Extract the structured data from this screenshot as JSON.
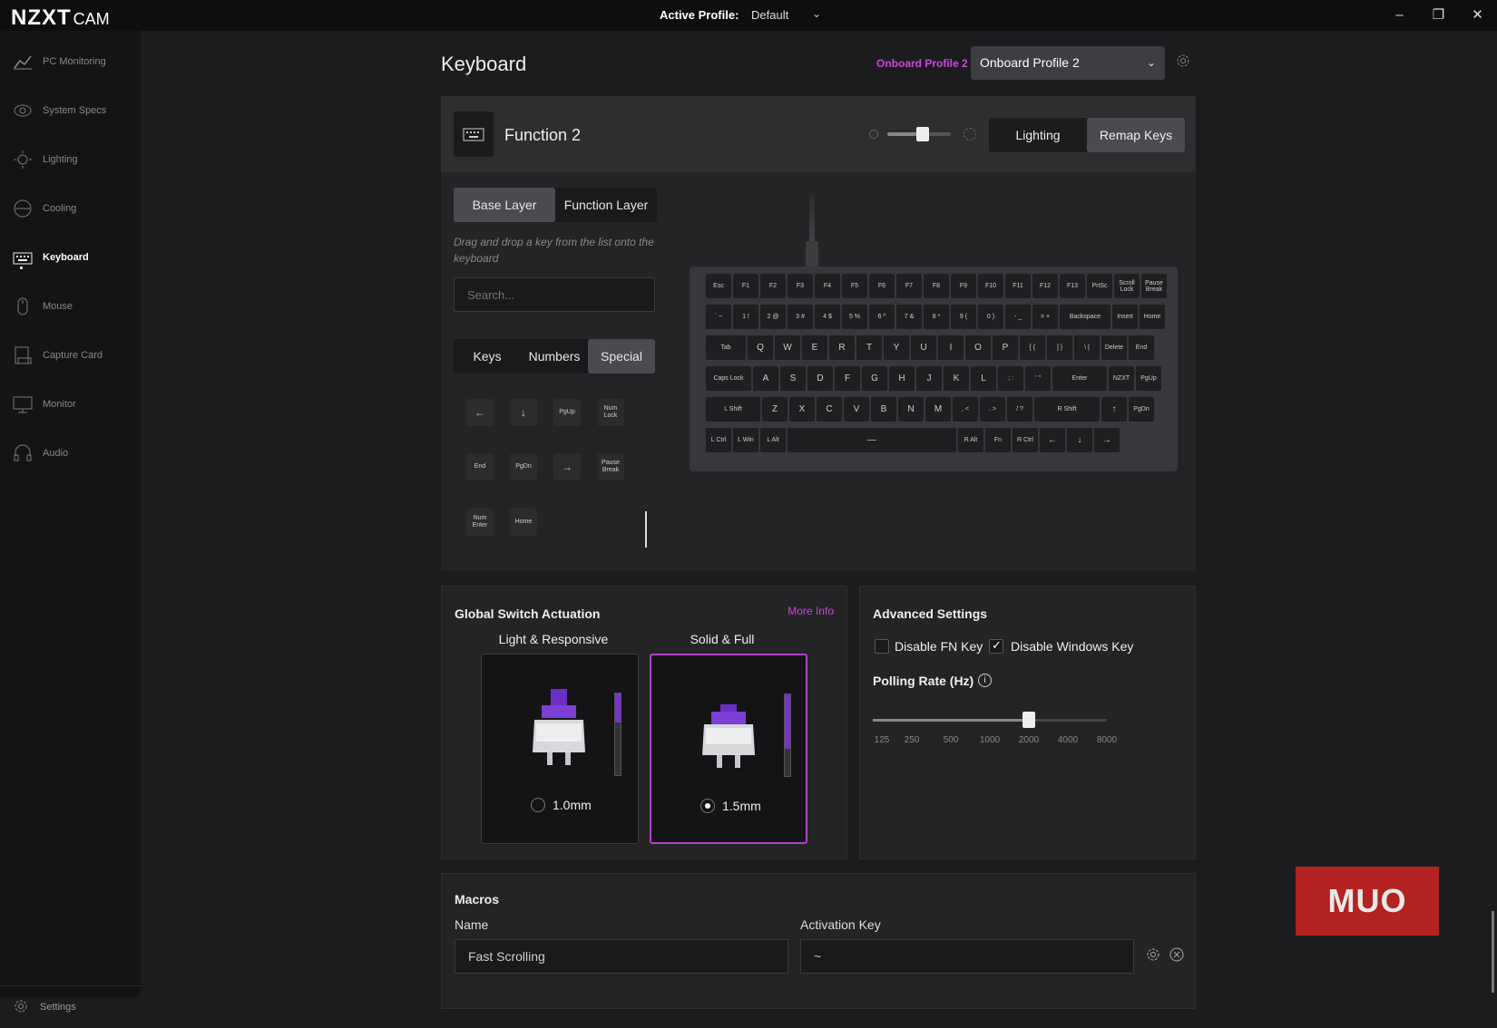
{
  "app": {
    "brand": "NZXT",
    "brand_suffix": "CAM"
  },
  "titlebar": {
    "active_profile_label": "Active Profile:",
    "active_profile_value": "Default"
  },
  "sidebar": {
    "items": [
      {
        "label": "PC Monitoring",
        "icon": "chart-icon"
      },
      {
        "label": "System Specs",
        "icon": "eye-icon"
      },
      {
        "label": "Lighting",
        "icon": "sun-icon"
      },
      {
        "label": "Cooling",
        "icon": "fan-icon"
      },
      {
        "label": "Keyboard",
        "icon": "keyboard-icon",
        "active": true
      },
      {
        "label": "Mouse",
        "icon": "mouse-icon"
      },
      {
        "label": "Capture Card",
        "icon": "capture-card-icon"
      },
      {
        "label": "Monitor",
        "icon": "monitor-icon"
      },
      {
        "label": "Audio",
        "icon": "headset-icon"
      }
    ],
    "settings_label": "Settings"
  },
  "page": {
    "title": "Keyboard",
    "onboard_label": "Onboard Profile 2",
    "profile_select": "Onboard Profile 2"
  },
  "device": {
    "name": "Function 2",
    "brightness_level": 0.5,
    "mode_tabs": [
      "Lighting",
      "Remap Keys"
    ],
    "active_mode": "Remap Keys"
  },
  "remap": {
    "layer_tabs": [
      "Base Layer",
      "Function Layer"
    ],
    "active_layer": "Base Layer",
    "hint": "Drag and drop a key from the list onto the keyboard",
    "search_placeholder": "Search...",
    "category_tabs": [
      "Keys",
      "Numbers",
      "Special"
    ],
    "active_category": "Special",
    "special_keys": [
      [
        "←",
        "↓",
        "PgUp",
        "Num Lock"
      ],
      [
        "End",
        "PgDn",
        "→",
        "Pause Break"
      ],
      [
        "Num Enter",
        "Home"
      ]
    ]
  },
  "keyboard_layout": {
    "row1": [
      "Esc",
      "F1",
      "F2",
      "F3",
      "F4",
      "F5",
      "F6",
      "F7",
      "F8",
      "F9",
      "F10",
      "F11",
      "F12",
      "F13",
      "PrtSc",
      "Scroll Lock",
      "Pause Break"
    ],
    "row2": [
      "` ~",
      "1 !",
      "2 @",
      "3 #",
      "4 $",
      "5 %",
      "6 ^",
      "7 &",
      "8 *",
      "9 (",
      "0 )",
      "- _",
      "= +",
      "Backspace",
      "Insert",
      "Home"
    ],
    "row3": [
      "Tab",
      "Q",
      "W",
      "E",
      "R",
      "T",
      "Y",
      "U",
      "I",
      "O",
      "P",
      "[ {",
      "] }",
      "\\ |",
      "Delete",
      "End"
    ],
    "row4": [
      "Caps Lock",
      "A",
      "S",
      "D",
      "F",
      "G",
      "H",
      "J",
      "K",
      "L",
      "; :",
      "' \"",
      "Enter",
      "NZXT",
      "PgUp"
    ],
    "row5": [
      "L Shift",
      "Z",
      "X",
      "C",
      "V",
      "B",
      "N",
      "M",
      ", <",
      ". >",
      "/ ?",
      "R Shift",
      "↑",
      "PgDn"
    ],
    "row6": [
      "L Ctrl",
      "L Win",
      "L Alt",
      "—",
      "R Alt",
      "Fn",
      "R Ctrl",
      "←",
      "↓",
      "→"
    ]
  },
  "actuation": {
    "title": "Global Switch Actuation",
    "more_info": "More Info",
    "options": [
      {
        "label": "Light & Responsive",
        "value": "1.0mm",
        "selected": false,
        "level": 0.35
      },
      {
        "label": "Solid & Full",
        "value": "1.5mm",
        "selected": true,
        "level": 0.65
      }
    ]
  },
  "advanced": {
    "title": "Advanced Settings",
    "disable_fn": {
      "label": "Disable FN Key",
      "checked": false
    },
    "disable_win": {
      "label": "Disable Windows Key",
      "checked": true
    },
    "polling_title": "Polling Rate (Hz)",
    "polling_ticks": [
      "125",
      "250",
      "500",
      "1000",
      "2000",
      "4000",
      "8000"
    ],
    "polling_value": "2000"
  },
  "macros": {
    "title": "Macros",
    "name_label": "Name",
    "name_value": "Fast Scrolling",
    "key_label": "Activation Key",
    "key_value": "~"
  },
  "watermark": "MUO"
}
